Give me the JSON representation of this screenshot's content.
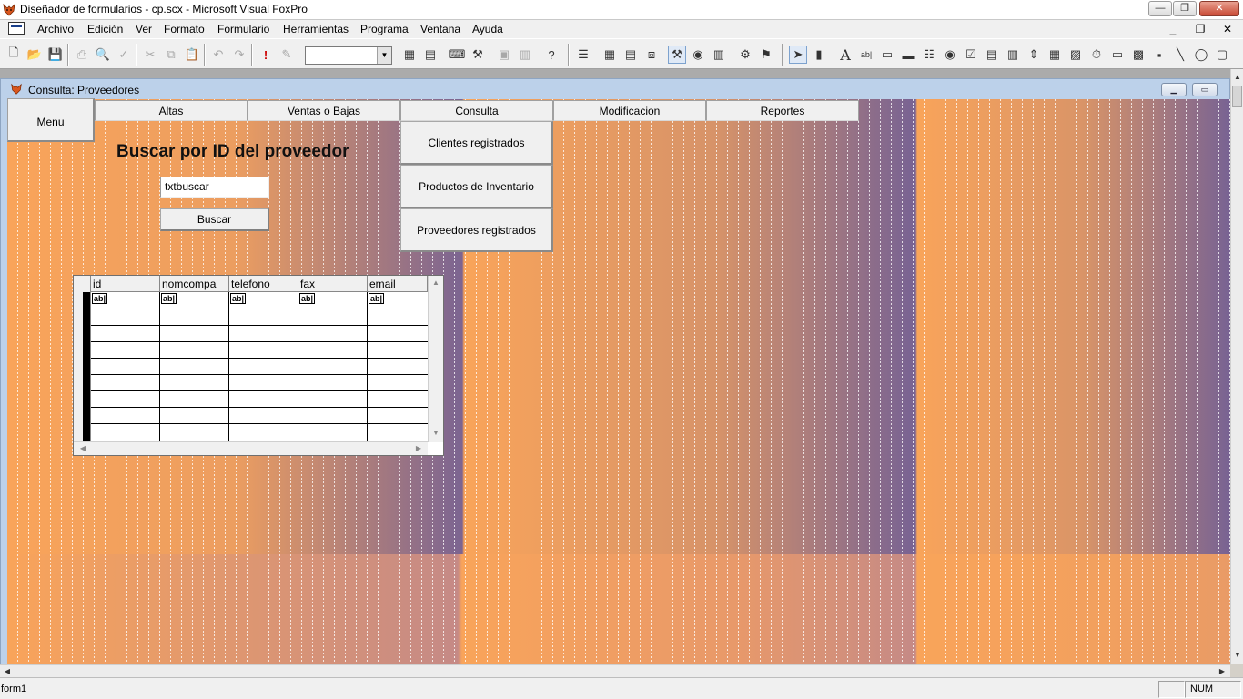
{
  "window": {
    "title": "Diseñador de formularios - cp.scx - Microsoft Visual FoxPro",
    "min": "—",
    "max": "❐",
    "close": "✕"
  },
  "menu": {
    "items": [
      "Archivo",
      "Edición",
      "Ver",
      "Formato",
      "Formulario",
      "Herramientas",
      "Programa",
      "Ventana",
      "Ayuda"
    ],
    "mdi_min": "_",
    "mdi_restore": "❐",
    "mdi_close": "✕"
  },
  "toolbar": {
    "combo_value": "",
    "icons": [
      "new-icon",
      "open-icon",
      "save-icon",
      "print-icon",
      "print-preview-icon",
      "spell-check-icon",
      "cut-icon",
      "copy-icon",
      "paste-icon",
      "undo-icon",
      "redo-icon",
      "run-icon",
      "modify-icon",
      "data-environment-icon",
      "properties-window-icon",
      "code-window-icon",
      "form-control-toolbar-icon",
      "color-palette-icon",
      "layout-toolbar-icon",
      "form-builder-icon",
      "autoformat-icon",
      "help-icon"
    ]
  },
  "form_window": {
    "title": "Consulta: Proveedores"
  },
  "pageframe": {
    "menu_tab": "Menu",
    "tabs": [
      "Altas",
      "Ventas o Bajas",
      "Consulta",
      "Modificacion",
      "Reportes"
    ],
    "consulta_options": [
      "Clientes registrados",
      "Productos de Inventario",
      "Proveedores registrados"
    ]
  },
  "search": {
    "heading": "Buscar por ID del proveedor",
    "textbox_value": "txtbuscar",
    "button_label": "Buscar"
  },
  "grid": {
    "columns": [
      "id",
      "nomcompa",
      "telefono",
      "fax",
      "email"
    ],
    "cell_placeholder": "ab|"
  },
  "status": {
    "left_text": "form1",
    "num": "NUM"
  },
  "colors": {
    "canvas_orange": "#f9a45a",
    "canvas_purple": "#715f96",
    "form_title_bg": "#bcd1ea"
  }
}
